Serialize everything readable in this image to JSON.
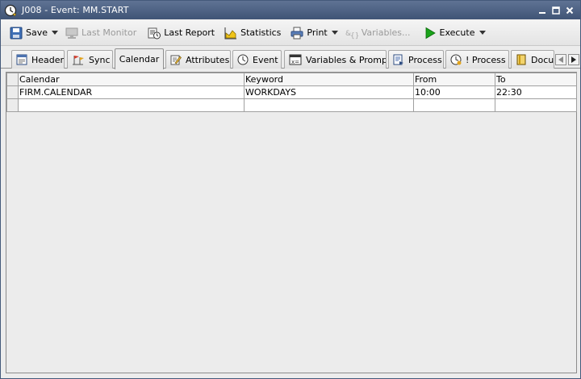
{
  "window": {
    "title": "J008 - Event: MM.START"
  },
  "toolbar": {
    "save": "Save",
    "last_monitor": "Last Monitor",
    "last_report": "Last Report",
    "statistics": "Statistics",
    "print": "Print",
    "variables": "Variables...",
    "execute": "Execute"
  },
  "tabs": [
    {
      "label": "Header"
    },
    {
      "label": "Sync"
    },
    {
      "label": "Calendar"
    },
    {
      "label": "Attributes"
    },
    {
      "label": "Event"
    },
    {
      "label": "Variables & Prompts"
    },
    {
      "label": "Process"
    },
    {
      "label": "! Process"
    },
    {
      "label": "Docu..."
    }
  ],
  "active_tab": "Calendar",
  "grid": {
    "columns": [
      "Calendar",
      "Keyword",
      "From",
      "To"
    ],
    "rows": [
      [
        "FIRM.CALENDAR",
        "WORKDAYS",
        "10:00",
        "22:30"
      ],
      [
        "",
        "",
        "",
        ""
      ]
    ]
  },
  "colors": {
    "titlebar": "#4f6485",
    "execute_green": "#1aa31a"
  }
}
